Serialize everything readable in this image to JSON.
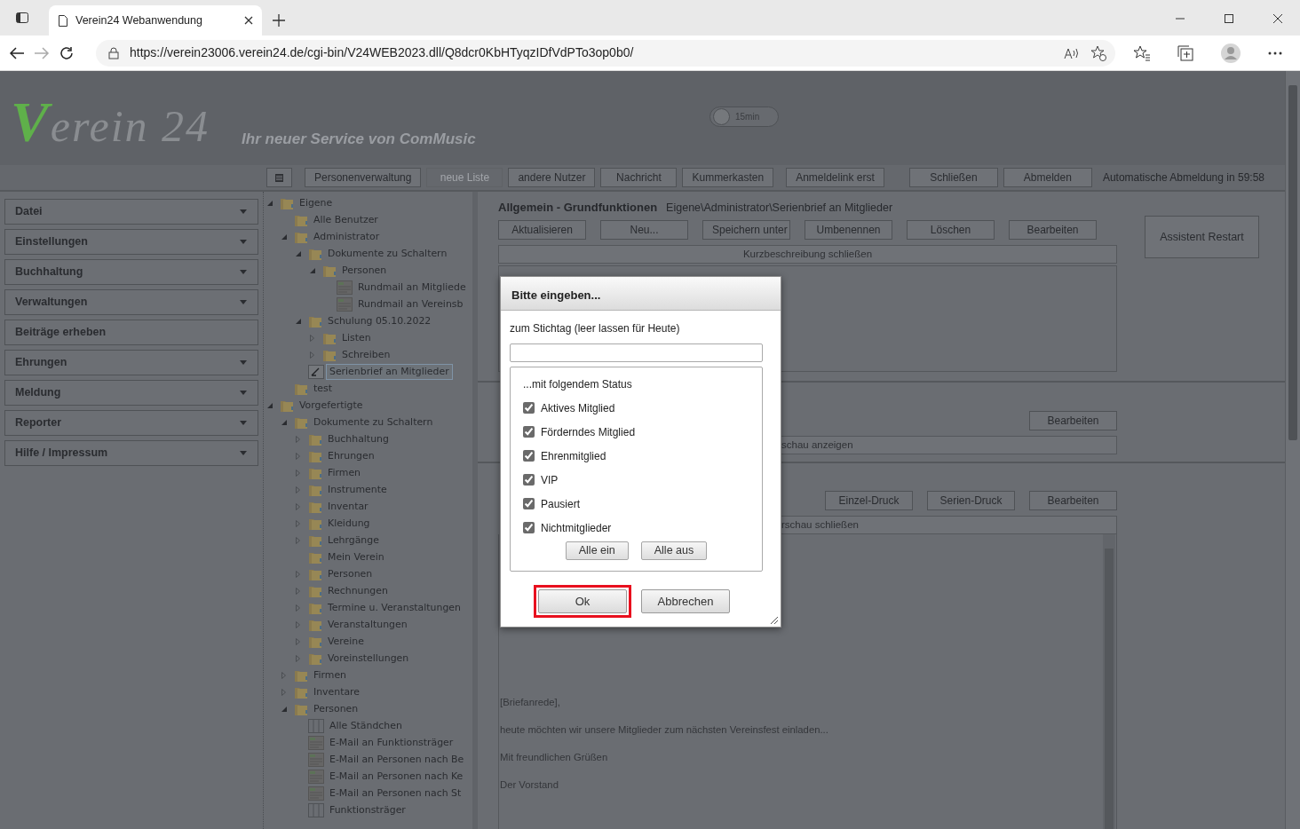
{
  "browser": {
    "tab_title": "Verein24 Webanwendung",
    "url": "https://verein23006.verein24.de/cgi-bin/V24WEB2023.dll/Q8dcr0KbHTyqzIDfVdPTo3op0b0/"
  },
  "header": {
    "logo": {
      "initial": "V",
      "rest": "erein 24"
    },
    "tagline": "Ihr neuer Service von ComMusic",
    "timer": {
      "label": "15min",
      "on": false
    }
  },
  "toolbar": {
    "buttons": [
      {
        "kind": "icon",
        "disabled": false
      },
      {
        "kind": "text",
        "label": "Personenverwaltung",
        "disabled": false
      },
      {
        "kind": "text",
        "label": "neue Liste",
        "disabled": true
      },
      {
        "kind": "text",
        "label": "andere Nutzer",
        "disabled": false
      },
      {
        "kind": "text",
        "label": "Nachricht",
        "disabled": false
      },
      {
        "kind": "text",
        "label": "Kummerkasten",
        "disabled": false
      },
      {
        "kind": "text",
        "label": "Anmeldelink erst",
        "disabled": false
      },
      {
        "kind": "text",
        "label": "Schließen",
        "disabled": false
      },
      {
        "kind": "text",
        "label": "Abmelden",
        "disabled": false
      }
    ],
    "status": "Automatische Abmeldung in 59:58"
  },
  "sidebar": {
    "items": [
      {
        "label": "Datei",
        "dropdown": true
      },
      {
        "label": "Einstellungen",
        "dropdown": true
      },
      {
        "label": "Buchhaltung",
        "dropdown": true
      },
      {
        "label": "Verwaltungen",
        "dropdown": true
      },
      {
        "label": "Beiträge erheben",
        "dropdown": false
      },
      {
        "label": "Ehrungen",
        "dropdown": true
      },
      {
        "label": "Meldung",
        "dropdown": true
      },
      {
        "label": "Reporter",
        "dropdown": true
      },
      {
        "label": "Hilfe / Impressum",
        "dropdown": true
      }
    ]
  },
  "tree": [
    {
      "label": "Eigene",
      "kind": "folder",
      "expanded": true,
      "selected": false,
      "children": [
        {
          "label": "Alle Benutzer",
          "kind": "folder",
          "selected": false
        },
        {
          "label": "Administrator",
          "kind": "folder",
          "expanded": true,
          "selected": false,
          "children": [
            {
              "label": "Dokumente zu Schaltern",
              "kind": "folder",
              "expanded": true,
              "selected": false,
              "children": [
                {
                  "label": "Personen",
                  "kind": "folder",
                  "expanded": true,
                  "selected": false,
                  "children": [
                    {
                      "label": "Rundmail an Mitgliede",
                      "kind": "mail",
                      "selected": false
                    },
                    {
                      "label": "Rundmail an Vereinsb",
                      "kind": "mail",
                      "selected": false
                    }
                  ]
                }
              ]
            },
            {
              "label": "Schulung 05.10.2022",
              "kind": "folder",
              "expanded": true,
              "selected": false,
              "children": [
                {
                  "label": "Listen",
                  "kind": "folder",
                  "expanded": false,
                  "selected": false
                },
                {
                  "label": "Schreiben",
                  "kind": "folder",
                  "expanded": false,
                  "selected": false
                }
              ]
            },
            {
              "label": "Serienbrief an Mitglieder",
              "kind": "letter",
              "selected": true
            }
          ]
        },
        {
          "label": "test",
          "kind": "folder",
          "selected": false
        }
      ]
    },
    {
      "label": "Vorgefertigte",
      "kind": "folder",
      "expanded": true,
      "selected": false,
      "children": [
        {
          "label": "Dokumente zu Schaltern",
          "kind": "folder",
          "expanded": true,
          "selected": false,
          "children": [
            {
              "label": "Buchhaltung",
              "kind": "folder",
              "expanded": false,
              "selected": false
            },
            {
              "label": "Ehrungen",
              "kind": "folder",
              "expanded": false,
              "selected": false
            },
            {
              "label": "Firmen",
              "kind": "folder",
              "expanded": false,
              "selected": false
            },
            {
              "label": "Instrumente",
              "kind": "folder",
              "expanded": false,
              "selected": false
            },
            {
              "label": "Inventar",
              "kind": "folder",
              "expanded": false,
              "selected": false
            },
            {
              "label": "Kleidung",
              "kind": "folder",
              "expanded": false,
              "selected": false
            },
            {
              "label": "Lehrgänge",
              "kind": "folder",
              "expanded": false,
              "selected": false
            },
            {
              "label": "Mein Verein",
              "kind": "folder",
              "selected": false
            },
            {
              "label": "Personen",
              "kind": "folder",
              "expanded": false,
              "selected": false
            },
            {
              "label": "Rechnungen",
              "kind": "folder",
              "expanded": false,
              "selected": false
            },
            {
              "label": "Termine u. Veranstaltungen",
              "kind": "folder",
              "expanded": false,
              "selected": false
            },
            {
              "label": "Veranstaltungen",
              "kind": "folder",
              "expanded": false,
              "selected": false
            },
            {
              "label": "Vereine",
              "kind": "folder",
              "expanded": false,
              "selected": false
            },
            {
              "label": "Voreinstellungen",
              "kind": "folder",
              "expanded": false,
              "selected": false
            }
          ]
        },
        {
          "label": "Firmen",
          "kind": "folder",
          "expanded": false,
          "selected": false
        },
        {
          "label": "Inventare",
          "kind": "folder",
          "expanded": false,
          "selected": false
        },
        {
          "label": "Personen",
          "kind": "folder",
          "expanded": true,
          "selected": false,
          "children": [
            {
              "label": "Alle Ständchen",
              "kind": "list",
              "selected": false
            },
            {
              "label": "E-Mail an Funktionsträger",
              "kind": "mail",
              "selected": false
            },
            {
              "label": "E-Mail an Personen nach Be",
              "kind": "mail",
              "selected": false
            },
            {
              "label": "E-Mail an Personen nach Ke",
              "kind": "mail",
              "selected": false
            },
            {
              "label": "E-Mail an Personen nach St",
              "kind": "mail",
              "selected": false
            },
            {
              "label": "Funktionsträger",
              "kind": "list",
              "selected": false
            }
          ]
        }
      ]
    }
  ],
  "panel": {
    "title": "Allgemein - Grundfunktionen",
    "path": "Eigene\\Administrator\\Serienbrief an Mitglieder",
    "buttons": [
      "Aktualisieren",
      "Neu...",
      "Speichern unter",
      "Umbenennen",
      "Löschen",
      "Bearbeiten"
    ],
    "description_bar": "Kurzbeschreibung schließen",
    "side_button": "Assistent Restart"
  },
  "section_2": {
    "buttons": [
      "Bearbeiten"
    ],
    "bar": "schau anzeigen"
  },
  "section_3": {
    "buttons": [
      "Einzel-Druck",
      "Serien-Druck",
      "Bearbeiten"
    ],
    "bar": "rschau schließen",
    "document": [
      "[Briefanrede],",
      "heute möchten wir unsere Mitglieder zum nächsten Vereinsfest einladen...",
      "Mit freundlichen Grüßen",
      "Der Vorstand"
    ]
  },
  "dialog": {
    "title": "Bitte eingeben...",
    "field_label": "zum Stichtag (leer lassen für Heute)",
    "legend": "...mit folgendem Status",
    "options": [
      {
        "label": "Aktives Mitglied",
        "checked": true
      },
      {
        "label": "Förderndes Mitglied",
        "checked": true
      },
      {
        "label": "Ehrenmitglied",
        "checked": true
      },
      {
        "label": "VIP",
        "checked": true
      },
      {
        "label": "Pausiert",
        "checked": true
      },
      {
        "label": "Nichtmitglieder",
        "checked": true
      }
    ],
    "group_buttons": [
      "Alle ein",
      "Alle aus"
    ],
    "buttons": [
      {
        "label": "Ok",
        "highlighted": true
      },
      {
        "label": "Abbrechen",
        "highlighted": false
      }
    ]
  }
}
